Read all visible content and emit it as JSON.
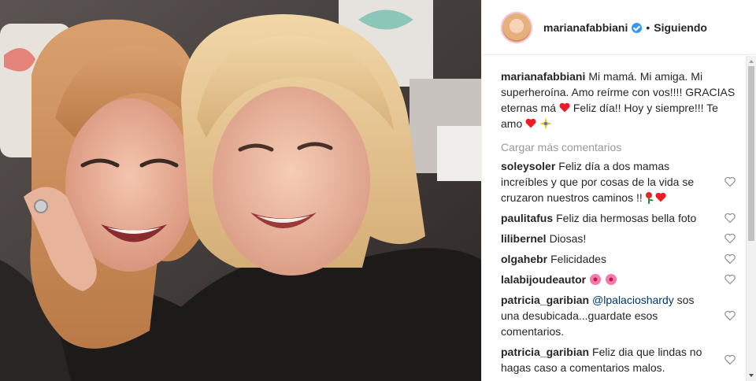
{
  "post": {
    "photo_alt": "post-photo",
    "author": "marianafabbiani",
    "follow_status": "Siguiendo",
    "separator": "•",
    "caption_part1": "Mi mamá. Mi amiga. Mi superheroína. Amo reírme con vos!!!! GRACIAS eternas má ",
    "caption_part2": " Feliz día!! Hoy y siempre!!! Te amo ",
    "load_more": "Cargar más comentarios"
  },
  "comments": [
    {
      "user": "soleysoler",
      "text": "Feliz día a dos mamas increíbles y que por cosas de la vida se cruzaron nuestros caminos !!",
      "emoji": [
        "rose-emoji",
        "red-heart-emoji"
      ]
    },
    {
      "user": "paulitafus",
      "text": "Feliz dia hermosas bella foto"
    },
    {
      "user": "lilibernel",
      "text": "Diosas!"
    },
    {
      "user": "olgahebr",
      "text": "Felicidades"
    },
    {
      "user": "lalabijoudeautor",
      "text": "",
      "emoji": [
        "hibiscus-emoji",
        "hibiscus-emoji"
      ]
    },
    {
      "user": "patricia_garibian",
      "mention": "@lpalacioshardy",
      "text": " sos una desubicada...guardate esos comentarios."
    },
    {
      "user": "patricia_garibian",
      "text": "Feliz dia que lindas no hagas caso a comentarios malos."
    }
  ],
  "colors": {
    "verified": "#3897f0",
    "muted": "#999999",
    "mention": "#003569",
    "heart": "#ed1c24"
  }
}
